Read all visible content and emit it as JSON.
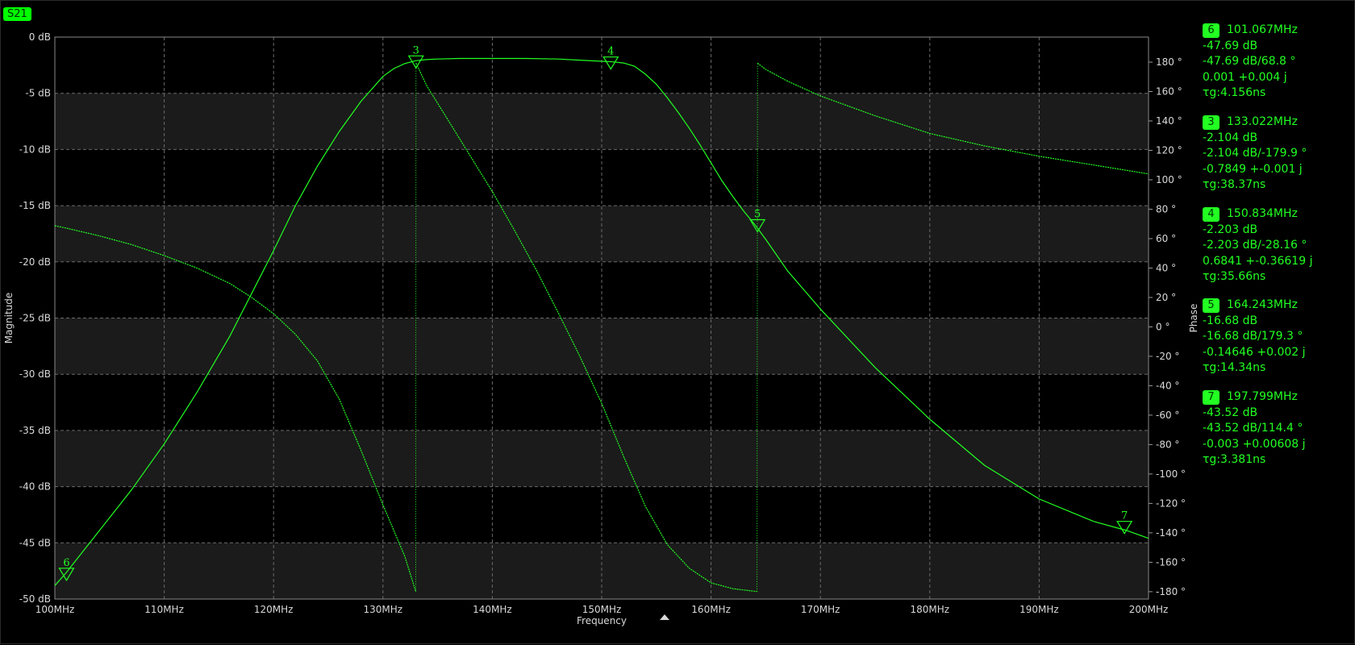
{
  "trace_label": "S21",
  "colors": {
    "trace": "#22ff22",
    "band": "#1b1b1b",
    "grid": "#6a6a6a",
    "text": "#d8d8d8",
    "background": "#000000"
  },
  "chart_data": {
    "type": "line",
    "title": "",
    "xlabel": "Frequency",
    "ylabel": "Magnitude",
    "y2label": "Phase",
    "xlim": [
      100,
      200
    ],
    "ylim": [
      -50,
      0
    ],
    "y2lim": [
      -185,
      197
    ],
    "x_ticks": [
      "100MHz",
      "110MHz",
      "120MHz",
      "130MHz",
      "140MHz",
      "150MHz",
      "160MHz",
      "170MHz",
      "180MHz",
      "190MHz",
      "200MHz"
    ],
    "y_ticks": [
      "0 dB",
      "-5 dB",
      "-10 dB",
      "-15 dB",
      "-20 dB",
      "-25 dB",
      "-30 dB",
      "-35 dB",
      "-40 dB",
      "-45 dB",
      "-50 dB"
    ],
    "y2_ticks": [
      "180 °",
      "160 °",
      "140 °",
      "120 °",
      "100 °",
      "80 °",
      "60 °",
      "40 °",
      "20 °",
      "0 °",
      "-20 °",
      "-40 °",
      "-60 °",
      "-80 °",
      "-100 °",
      "-120 °",
      "-140 °",
      "-160 °",
      "-180 °"
    ],
    "series": [
      {
        "axis": "left",
        "x": [
          100,
          101,
          104,
          107,
          110,
          113,
          116,
          118,
          120,
          122,
          124,
          126,
          128,
          130,
          131,
          132,
          133,
          134,
          135,
          137,
          140,
          143,
          146,
          148,
          150,
          151,
          152,
          153,
          154,
          155,
          156,
          157,
          158,
          159,
          160,
          161,
          162,
          163,
          164,
          165,
          167,
          170,
          175,
          180,
          185,
          190,
          195,
          198,
          200
        ],
        "values": [
          -48.8,
          -47.7,
          -44.0,
          -40.3,
          -36.2,
          -31.6,
          -26.6,
          -22.8,
          -19.0,
          -15.0,
          -11.5,
          -8.4,
          -5.7,
          -3.5,
          -2.8,
          -2.35,
          -2.1,
          -2.0,
          -1.95,
          -1.9,
          -1.9,
          -1.9,
          -1.95,
          -2.05,
          -2.15,
          -2.2,
          -2.3,
          -2.6,
          -3.3,
          -4.2,
          -5.4,
          -6.7,
          -8.1,
          -9.6,
          -11.2,
          -12.8,
          -14.2,
          -15.5,
          -16.68,
          -18.0,
          -20.8,
          -24.2,
          -29.4,
          -34.0,
          -38.1,
          -41.1,
          -43.1,
          -43.9,
          -44.6
        ]
      },
      {
        "axis": "right",
        "x": [
          100,
          101,
          104,
          107,
          110,
          113,
          116,
          118,
          120,
          122,
          124,
          126,
          128,
          130,
          132,
          133,
          133.02,
          134,
          136,
          138,
          140,
          142,
          144,
          146,
          148,
          150,
          152,
          154,
          156,
          158,
          160,
          162,
          164.2,
          164.25,
          165,
          167,
          170,
          175,
          180,
          185,
          190,
          195,
          200
        ],
        "values": [
          68.8,
          67.2,
          62.0,
          56.0,
          48.5,
          40.0,
          29.5,
          20.0,
          9.0,
          -5.0,
          -23.0,
          -49.0,
          -84.0,
          -121.0,
          -156.0,
          -179.9,
          179.3,
          164.0,
          140.0,
          116.0,
          92.0,
          66.0,
          39.0,
          10.0,
          -20.0,
          -52.0,
          -88.0,
          -122.0,
          -148.0,
          -164.0,
          -174.0,
          -178.0,
          -179.9,
          179.3,
          175.0,
          167.0,
          157.0,
          143.5,
          131.5,
          123.0,
          116.0,
          110.0,
          104.0
        ]
      }
    ],
    "markers": [
      {
        "id": "6",
        "freq": "101.067MHz",
        "mag": "-47.69 dB",
        "magphase": "-47.69 dB/68.8 °",
        "complex": "0.001 +0.004 j",
        "delay": "τg:4.156ns",
        "x": 101.067,
        "y": -47.69
      },
      {
        "id": "3",
        "freq": "133.022MHz",
        "mag": "-2.104 dB",
        "magphase": "-2.104 dB/-179.9 °",
        "complex": "-0.7849 +-0.001 j",
        "delay": "τg:38.37ns",
        "x": 133.022,
        "y": -2.104
      },
      {
        "id": "4",
        "freq": "150.834MHz",
        "mag": "-2.203 dB",
        "magphase": "-2.203 dB/-28.16 °",
        "complex": "0.6841 +-0.36619 j",
        "delay": "τg:35.66ns",
        "x": 150.834,
        "y": -2.203
      },
      {
        "id": "5",
        "freq": "164.243MHz",
        "mag": "-16.68 dB",
        "magphase": "-16.68 dB/179.3 °",
        "complex": "-0.14646 +0.002 j",
        "delay": "τg:14.34ns",
        "x": 164.243,
        "y": -16.68
      },
      {
        "id": "7",
        "freq": "197.799MHz",
        "mag": "-43.52 dB",
        "magphase": "-43.52 dB/114.4 °",
        "complex": "-0.003 +0.00608 j",
        "delay": "τg:3.381ns",
        "x": 197.799,
        "y": -43.52
      }
    ]
  }
}
